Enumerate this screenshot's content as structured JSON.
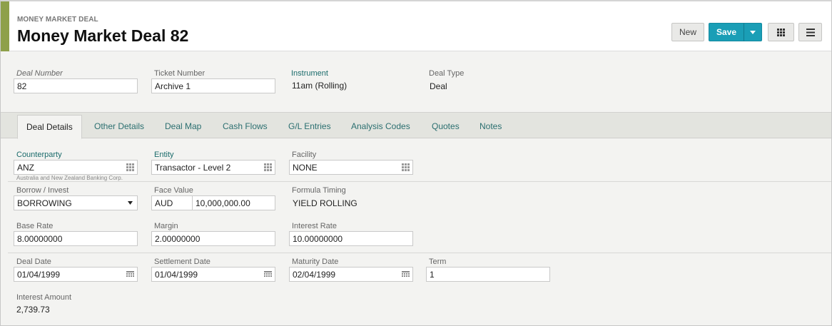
{
  "header": {
    "subtitle": "MONEY MARKET DEAL",
    "title": "Money Market Deal 82",
    "new_label": "New",
    "save_label": "Save",
    "icons": [
      "chevron-down-icon",
      "grid-icon",
      "menu-icon"
    ]
  },
  "summary": {
    "deal_number_label": "Deal Number",
    "deal_number_value": "82",
    "ticket_number_label": "Ticket Number",
    "ticket_number_value": "Archive 1",
    "instrument_label": "Instrument",
    "instrument_value": "11am (Rolling)",
    "deal_type_label": "Deal Type",
    "deal_type_value": "Deal"
  },
  "tabs": [
    {
      "label": "Deal Details",
      "active": true
    },
    {
      "label": "Other Details"
    },
    {
      "label": "Deal Map"
    },
    {
      "label": "Cash Flows"
    },
    {
      "label": "G/L Entries"
    },
    {
      "label": "Analysis Codes"
    },
    {
      "label": "Quotes"
    },
    {
      "label": "Notes"
    }
  ],
  "details": {
    "counterparty_label": "Counterparty",
    "counterparty_value": "ANZ",
    "counterparty_hint": "Australia and New Zealand Banking Corp.",
    "entity_label": "Entity",
    "entity_value": "Transactor - Level 2",
    "facility_label": "Facility",
    "facility_value": "NONE",
    "borrow_label": "Borrow / Invest",
    "borrow_value": "BORROWING",
    "face_value_label": "Face Value",
    "face_currency": "AUD",
    "face_amount": "10,000,000.00",
    "formula_timing_label": "Formula Timing",
    "formula_timing_value": "YIELD ROLLING",
    "base_rate_label": "Base Rate",
    "base_rate_value": "8.00000000",
    "margin_label": "Margin",
    "margin_value": "2.00000000",
    "interest_rate_label": "Interest Rate",
    "interest_rate_value": "10.00000000",
    "deal_date_label": "Deal Date",
    "deal_date_value": "01/04/1999",
    "settlement_date_label": "Settlement Date",
    "settlement_date_value": "01/04/1999",
    "maturity_date_label": "Maturity Date",
    "maturity_date_value": "02/04/1999",
    "term_label": "Term",
    "term_value": "1",
    "interest_amount_label": "Interest Amount",
    "interest_amount_value": "2,739.73"
  },
  "colors": {
    "accent": "#8ea04a",
    "primary_button": "#1a9eb6",
    "link_label": "#1a6b6b"
  }
}
